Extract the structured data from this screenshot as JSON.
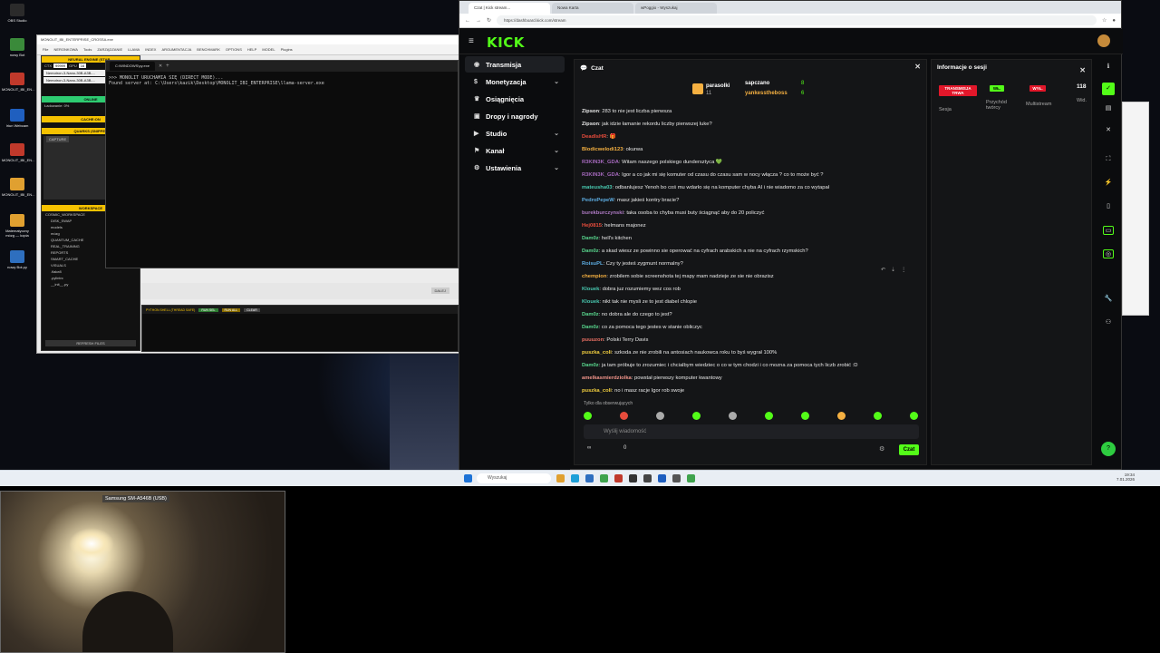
{
  "desktop": {
    "icons": [
      {
        "label": "OBS Studio",
        "color": "#2b2b2b"
      },
      {
        "label": "nowy Bot",
        "color": "#3a8a3a"
      },
      {
        "label": "MONOLIT_IBI_EN...",
        "color": "#c0392b"
      },
      {
        "label": "Iriun Webcam",
        "color": "#1f5fbf"
      },
      {
        "label": "MONOLIT_IBI_EN...",
        "color": "#c0392b"
      },
      {
        "label": "MONOLIT_IBI_EN...",
        "color": "#e0a030"
      },
      {
        "label": "Matematyczny mózg — kopia",
        "color": "#e0a030"
      },
      {
        "label": "nowy Bot.py",
        "color": "#2e6fbf"
      }
    ]
  },
  "ide": {
    "title": "MONOLIT_IBI_ENTERPRISE_CROSSA.exe",
    "menu": [
      "File",
      "NERONKOWA",
      "Tools",
      "ZARZĄDZANIE",
      "LLAMA",
      "INDEX",
      "ARGUMENTACJA",
      "BENCHMARK",
      "OPTIONS",
      "HELP",
      "MODEL",
      "Plugins"
    ],
    "neural_title": "NEURAL ENGINE (STAR...",
    "ctx_label": "CTX",
    "ctx_value": "99999",
    "gpu_label": "GPU",
    "gpu_value": "16",
    "models": [
      "Nemotron-3-Nano-30B-A3B-...",
      "Nemotron-3-Nano-30B-A3B-..."
    ],
    "online": "ONLINE",
    "loading": "Ładowanie: 0%",
    "cache": "CACHE:ON",
    "quarks": "QUARKS (SNIPPET",
    "capture": "CAPTURE",
    "workspace": "WORKSPACE",
    "tree": [
      "COSMIC_WORKSPACE",
      "DISK_SWAP",
      "models",
      "mózg",
      "QUANTUM_CACHE",
      "REAL_TRAINING",
      "REPORTS",
      "SMART_CACHE",
      "VISUALS",
      ".flake8",
      ".pylintrc",
      "__init__.py"
    ],
    "refresh": "REFRESH FILES"
  },
  "terminal": {
    "tab": "C:\\WINDOWS\\py.exe",
    "lines": [
      ">>> MONOLIT URUCHAMIA SIĘ (DIRECT MODE)...",
      "Found server at: C:\\Users\\kazik\\Desktop\\MONOLIT_IBI_ENTERPRISE\\llama-server.exe"
    ]
  },
  "pyshell": {
    "title": "PYTHON SHELL (THREAD SAFE)",
    "buttons": [
      "RUN SEL",
      "RUN ALL",
      "CLEAR"
    ],
    "dalej": "DALEJ"
  },
  "browser": {
    "tabs": [
      "Czat | Kick stream...",
      "Nowa Karta",
      "wPoggio - Wyszukaj"
    ],
    "url": "https://dashboard.kick.com/stream"
  },
  "kick": {
    "logo": "KICK",
    "nav": [
      {
        "label": "Transmisja",
        "icon": "broadcast-icon",
        "glyph": "◉"
      },
      {
        "label": "Monetyzacja",
        "icon": "money-icon",
        "glyph": "$"
      },
      {
        "label": "Osiągnięcia",
        "icon": "trophy-icon",
        "glyph": "♛"
      },
      {
        "label": "Dropy i nagrody",
        "icon": "gift-icon",
        "glyph": "▣"
      },
      {
        "label": "Studio",
        "icon": "studio-icon",
        "glyph": "▶"
      },
      {
        "label": "Kanał",
        "icon": "channel-icon",
        "glyph": "⚑"
      },
      {
        "label": "Ustawienia",
        "icon": "settings-icon",
        "glyph": "⚙"
      }
    ]
  },
  "chat": {
    "title": "Czat",
    "leaderboard": [
      {
        "name": "parasolki",
        "count": "11"
      },
      {
        "name": "sapczano",
        "count": "8"
      },
      {
        "name": "yankesstheboss",
        "count": "6"
      }
    ],
    "messages": [
      {
        "user": "Zipson",
        "color": "#e8e8e8",
        "text": "283 to nie jest liczba pierwsza"
      },
      {
        "user": "Zipson",
        "color": "#e8e8e8",
        "text": "jak idzie łamanie rekordu liczby pierwszej luke?"
      },
      {
        "user": "DeadIsHR",
        "color": "#e74c3c",
        "text": "🎁"
      },
      {
        "user": "Blodicwelodi123",
        "color": "#f5b041",
        "text": "okurwa"
      },
      {
        "user": "R3KIN3K_GDA",
        "color": "#a569bd",
        "text": "Witam naszego polskiego dundersztyca 💚"
      },
      {
        "user": "R3KIN3K_GDA",
        "color": "#a569bd",
        "text": "Igor a co jak mi się komuter od czasu do czasu sam w nocy włącza ? co to może być ?"
      },
      {
        "user": "mateusha03",
        "color": "#48c9b0",
        "text": "odbanlujesz Yenoh bo coś mu wdarło się na komputer chyba AI i nie wiadomo za co wytapał"
      },
      {
        "user": "PedroPepeW",
        "color": "#5dade2",
        "text": "masz jakieś kontry bracie?"
      },
      {
        "user": "burekburczynski",
        "color": "#af7ac5",
        "text": "taka osoba to chyba musi buty ściągnąć aby do 20 policzyć"
      },
      {
        "user": "Hej0815",
        "color": "#e74c3c",
        "text": "helmans majonez"
      },
      {
        "user": "Dam0z",
        "color": "#58d68d",
        "text": "hell's kitchen"
      },
      {
        "user": "Dam0z",
        "color": "#58d68d",
        "text": "a skad wiesz ze powinno sie operować na cyfrach arabskich a nie na cyfrach rzymskich?"
      },
      {
        "user": "RoisuPL",
        "color": "#5dade2",
        "text": "Czy ty jesteś zygmunt normalny?"
      },
      {
        "user": "chempion",
        "color": "#f5b041",
        "text": "zrobilem sobie screenshota tej mapy mam nadzieje ze sie nie obrazisz"
      },
      {
        "user": "Klouek",
        "color": "#48c9b0",
        "text": "dobra juz rozumiemy wez cos rob"
      },
      {
        "user": "Klouek",
        "color": "#48c9b0",
        "text": "nikt tak nie mysli ze to jest diabel chlopie"
      },
      {
        "user": "Dam0z",
        "color": "#58d68d",
        "text": "no dobra ale do czego to jest?"
      },
      {
        "user": "Dam0z",
        "color": "#58d68d",
        "text": "co za pomoca tego jestes w stanie obliczyc"
      },
      {
        "user": "puuuzon",
        "color": "#ec7063",
        "text": "Polski Terry Davis"
      },
      {
        "user": "puszka_coli",
        "color": "#f4d03f",
        "text": "szkoda ze nie zrobili na antosiach naukowca roku to byś wygrał 100%"
      },
      {
        "user": "Dam0z",
        "color": "#58d68d",
        "text": "ja tam próbuje to zrozumiec i chcialbym wiedziec o co w tym chodzi i co mozna za pomoca tych liczb zrobić :D"
      },
      {
        "user": "amelkasmierdziolka",
        "color": "#f1948a",
        "text": "powstał pierwszy komputer kwantowy"
      },
      {
        "user": "puszka_coli",
        "color": "#f4d03f",
        "text": "no i masz racje Igor rob swoje"
      }
    ],
    "followers_only": "Tylko dla obserwujących",
    "input_placeholder": "Wyślij wiadomość",
    "infinity": "∞",
    "zero": "0",
    "send": "Czat"
  },
  "session": {
    "title": "Informacje o sesji",
    "live_badge": "TRANSMISJA TRWA",
    "live_label": "Sesja",
    "income_badge": "WŁ.",
    "income_label": "Przychód twórcy",
    "multi_badge": "WYŁ.",
    "multi_label": "Multistream",
    "viewers": "118",
    "viewers_label": "Wid."
  },
  "taskbar": {
    "search": "Wyszukaj",
    "time": "19:34",
    "date": "7.01.2026"
  },
  "webcam": {
    "label": "Samsung SM-A546B (USB)"
  },
  "colors": {
    "kick_green": "#53fc18",
    "red_badge": "#e2172a"
  }
}
